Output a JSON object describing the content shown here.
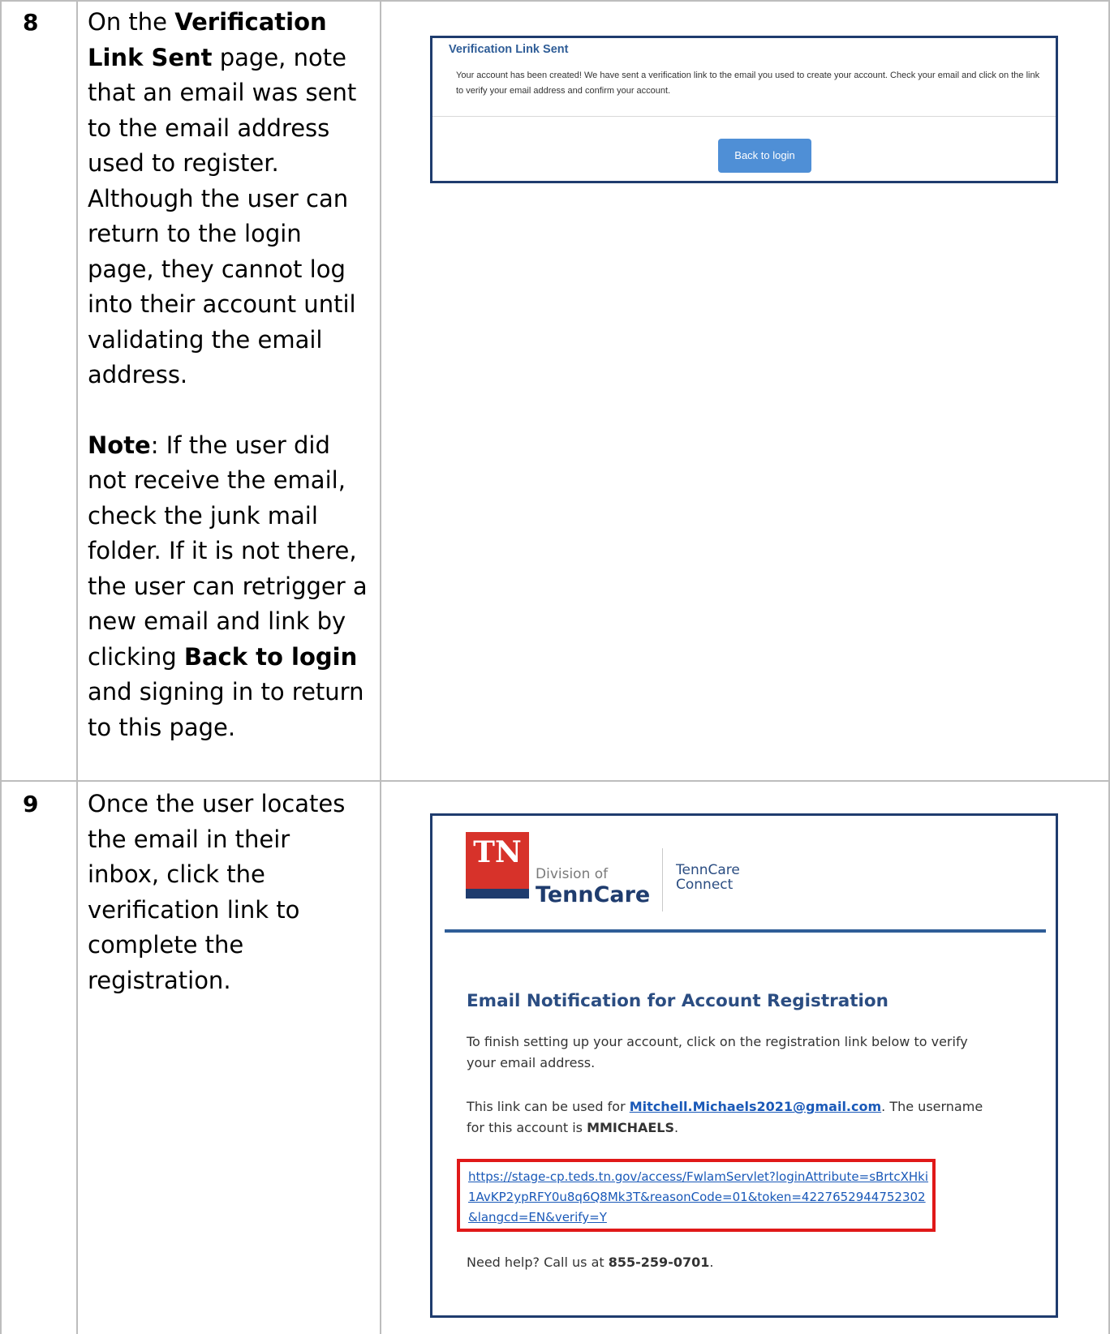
{
  "step8": {
    "number": "8",
    "t1": "On the ",
    "b1": "Verification Link Sent",
    "t2": " page, note that an email was sent to the email address used to register. Although the user can return to the login page, they cannot log into their account until validating the email address.",
    "note_label": "Note",
    "t3": ": If the user did not receive the email, check the junk mail folder. If it is not there, the user can retrigger a new email and link by clicking ",
    "b2": "Back to login",
    "t4": " and signing in to return to this page."
  },
  "step9": {
    "number": "9",
    "text": "Once the user locates the email in their inbox, click the verification link to complete the registration."
  },
  "verification_screen": {
    "title": "Verification Link Sent",
    "message": "Your account has been created! We have sent a verification link to the email you used to create your account. Check your email and click on the link to verify your email address and confirm your account.",
    "button_label": "Back to login"
  },
  "email_screen": {
    "logo_tn": "TN",
    "logo_division": "Division of",
    "logo_tenncare": "TennCare",
    "logo_connect_line1": "TennCare",
    "logo_connect_line2": "Connect",
    "title": "Email Notification for Account Registration",
    "para1": "To finish setting up your account, click on the registration link below to verify your email address.",
    "p2_a": "This link can be used for ",
    "email": "Mitchell.Michaels2021@gmail.com",
    "p2_b": ". The username for this account is ",
    "username": "MMICHAELS",
    "p2_c": ".",
    "link": "https://stage-cp.teds.tn.gov/access/FwlamServlet?loginAttribute=sBrtcXHki1AvKP2ypRFY0u8q6Q8Mk3T&reasonCode=01&token=4227652944752302&langcd=EN&verify=Y",
    "help_a": "Need help? Call us at ",
    "phone": "855-259-0701",
    "help_b": "."
  }
}
